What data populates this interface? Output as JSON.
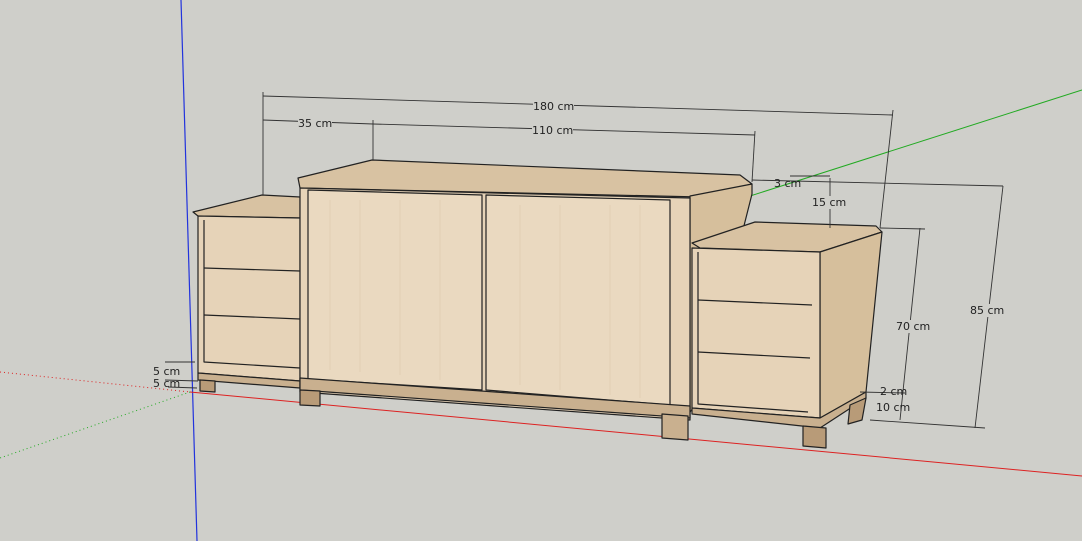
{
  "viewport": {
    "model": "sideboard with two bedside drawer units",
    "colors": {
      "background": "#cfcfca",
      "wood": "#e3cfb3",
      "wood_dark": "#c9b08f",
      "x_axis": "#d22",
      "y_axis": "#2a2",
      "z_axis": "#22d"
    }
  },
  "dimensions": {
    "total_width": "180 cm",
    "side_width": "35 cm",
    "center_width": "110 cm",
    "offset": "3 cm",
    "height_diff": "15 cm",
    "side_height": "70 cm",
    "total_height": "85 cm",
    "plinth_gap": "2 cm",
    "leg_height": "10 cm",
    "left_a": "5 cm",
    "left_b": "5 cm"
  }
}
